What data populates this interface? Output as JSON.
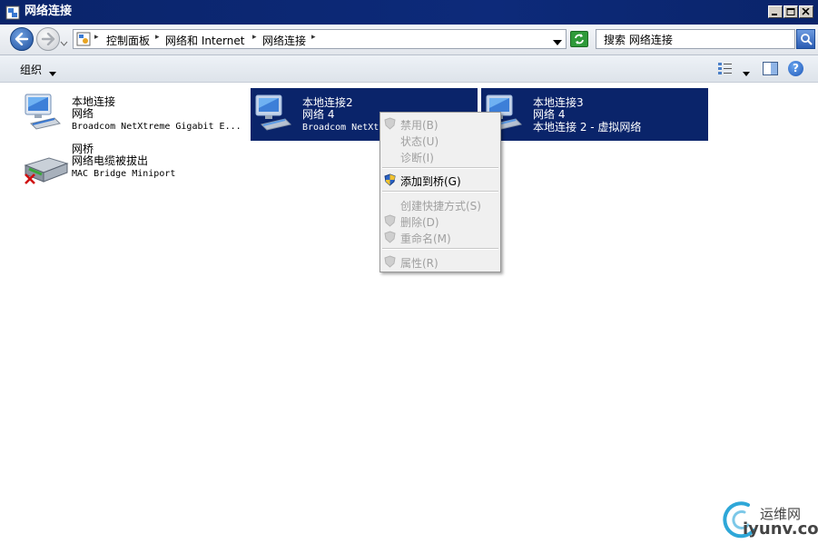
{
  "window": {
    "title": "网络连接"
  },
  "address": {
    "breadcrumbs": [
      "控制面板",
      "网络和 Internet",
      "网络连接"
    ]
  },
  "search": {
    "value": "搜索 网络连接"
  },
  "command_bar": {
    "organize_label": "组织"
  },
  "connections": [
    {
      "name": "本地连接",
      "network": "网络",
      "device": "Broadcom NetXtreme Gigabit E...",
      "selected": false
    },
    {
      "name": "本地连接2",
      "network": "网络  4",
      "device": "Broadcom NetXt",
      "selected": true
    },
    {
      "name": "本地连接3",
      "network": "网络  4",
      "device": "本地连接 2 - 虚拟网络",
      "selected": true
    },
    {
      "name": "网桥",
      "network": "网络电缆被拔出",
      "device": "MAC Bridge Miniport",
      "selected": false
    }
  ],
  "context_menu": {
    "items": [
      {
        "label": "禁用(B)",
        "enabled": false
      },
      {
        "label": "状态(U)",
        "enabled": false
      },
      {
        "label": "诊断(I)",
        "enabled": false
      },
      {
        "label": "添加到桥(G)",
        "enabled": true
      },
      {
        "label": "创建快捷方式(S)",
        "enabled": false
      },
      {
        "label": "删除(D)",
        "enabled": false
      },
      {
        "label": "重命名(M)",
        "enabled": false
      },
      {
        "label": "属性(R)",
        "enabled": false
      }
    ]
  },
  "watermark": {
    "cn": "运维网",
    "en": "iyunv.com"
  },
  "colors": {
    "titlebar": "#0a246a",
    "selection": "#0a246a",
    "menu_bg": "#f0f0f0",
    "disabled_text": "#a0a0a0"
  }
}
